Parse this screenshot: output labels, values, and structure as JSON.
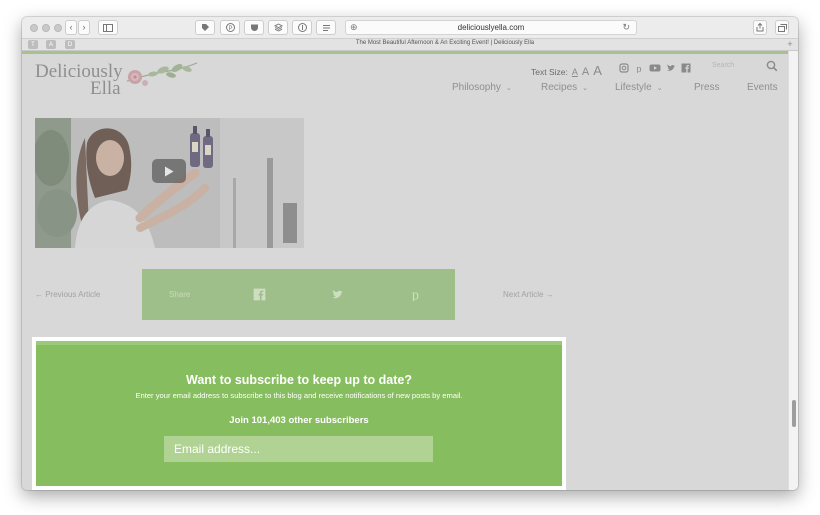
{
  "browser": {
    "url": "deliciouslyella.com",
    "tab_title": "The Most Beautiful Afternoon & An Exciting Event! | Deliciously Ella",
    "favorites": [
      "T",
      "A",
      "D"
    ]
  },
  "header": {
    "logo_line1": "Deliciously",
    "logo_line2": "Ella",
    "text_size_label": "Text Size:",
    "text_size_options": [
      "A",
      "A",
      "A"
    ],
    "social_icons": [
      "instagram-icon",
      "pinterest-icon",
      "youtube-icon",
      "twitter-icon",
      "facebook-icon"
    ],
    "search_placeholder": "Search"
  },
  "nav": {
    "items": [
      {
        "label": "Philosophy",
        "has_dropdown": true
      },
      {
        "label": "Recipes",
        "has_dropdown": true
      },
      {
        "label": "Lifestyle",
        "has_dropdown": true
      },
      {
        "label": "Press",
        "has_dropdown": false
      },
      {
        "label": "Events",
        "has_dropdown": false
      }
    ]
  },
  "article_nav": {
    "prev": "← Previous Article",
    "next": "Next Article →",
    "share_label": "Share",
    "share_icons": [
      "facebook-icon",
      "twitter-icon",
      "pinterest-icon"
    ]
  },
  "subscribe": {
    "title": "Want to subscribe to keep up to date?",
    "description": "Enter your email address to subscribe to this blog and receive notifications of new posts by email.",
    "count_text": "Join 101,403 other subscribers",
    "email_placeholder": "Email address..."
  },
  "colors": {
    "subscribe_green": "#86bd5e",
    "share_green": "#9fbf8a",
    "overlay_gray": "#d8d8d8"
  }
}
